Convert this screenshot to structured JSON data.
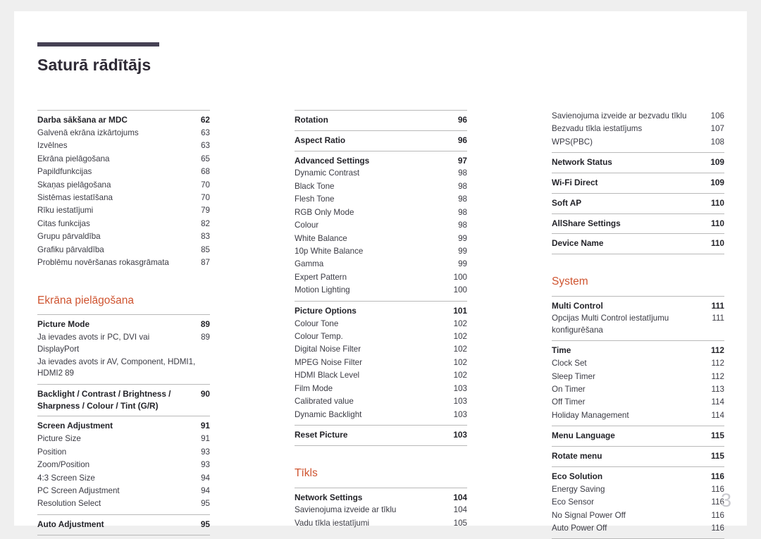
{
  "header": {
    "title": "Saturā rādītājs",
    "rule_color": "#454154",
    "accent_color": "#cf5430"
  },
  "folio": "3",
  "columns": [
    {
      "blocks": [
        {
          "type": "group",
          "entries": [
            {
              "label": "Darba sākšana ar MDC",
              "page": "62",
              "bold": true
            },
            {
              "label": "Galvenā ekrāna izkārtojums",
              "page": "63",
              "bold": false
            },
            {
              "label": "Izvēlnes",
              "page": "63",
              "bold": false
            },
            {
              "label": "Ekrāna pielāgošana",
              "page": "65",
              "bold": false
            },
            {
              "label": "Papildfunkcijas",
              "page": "68",
              "bold": false
            },
            {
              "label": "Skaņas pielāgošana",
              "page": "70",
              "bold": false
            },
            {
              "label": "Sistēmas iestatīšana",
              "page": "70",
              "bold": false
            },
            {
              "label": "Rīku iestatījumi",
              "page": "79",
              "bold": false
            },
            {
              "label": "Citas funkcijas",
              "page": "82",
              "bold": false
            },
            {
              "label": "Grupu pārvaldība",
              "page": "83",
              "bold": false
            },
            {
              "label": "Grafiku pārvaldība",
              "page": "85",
              "bold": false
            },
            {
              "label": "Problēmu novēršanas rokasgrāmata",
              "page": "87",
              "bold": false
            }
          ]
        },
        {
          "type": "heading",
          "label": "Ekrāna pielāgošana"
        },
        {
          "type": "group",
          "entries": [
            {
              "label": "Picture Mode",
              "page": "89",
              "bold": true
            },
            {
              "label": "Ja ievades avots ir PC, DVI vai DisplayPort",
              "page": "89",
              "bold": false,
              "tight": true
            },
            {
              "label": "Ja ievades avots ir AV, Component, HDMI1, HDMI2",
              "page": "89",
              "bold": false,
              "wrap": true
            }
          ]
        },
        {
          "type": "group",
          "entries": [
            {
              "label": "Backlight / Contrast / Brightness / Sharpness / Colour / Tint (G/R)",
              "page": "90",
              "bold": true
            }
          ]
        },
        {
          "type": "group",
          "entries": [
            {
              "label": "Screen Adjustment",
              "page": "91",
              "bold": true
            },
            {
              "label": "Picture Size",
              "page": "91",
              "bold": false
            },
            {
              "label": "Position",
              "page": "93",
              "bold": false
            },
            {
              "label": "Zoom/Position",
              "page": "93",
              "bold": false
            },
            {
              "label": "4:3 Screen Size",
              "page": "94",
              "bold": false
            },
            {
              "label": "PC Screen Adjustment",
              "page": "94",
              "bold": false
            },
            {
              "label": "Resolution Select",
              "page": "95",
              "bold": false
            }
          ]
        },
        {
          "type": "group",
          "last": true,
          "entries": [
            {
              "label": "Auto Adjustment",
              "page": "95",
              "bold": true
            }
          ]
        }
      ]
    },
    {
      "blocks": [
        {
          "type": "group",
          "entries": [
            {
              "label": "Rotation",
              "page": "96",
              "bold": true
            }
          ]
        },
        {
          "type": "group",
          "entries": [
            {
              "label": "Aspect Ratio",
              "page": "96",
              "bold": true
            }
          ]
        },
        {
          "type": "group",
          "entries": [
            {
              "label": "Advanced Settings",
              "page": "97",
              "bold": true
            },
            {
              "label": "Dynamic Contrast",
              "page": "98",
              "bold": false
            },
            {
              "label": "Black Tone",
              "page": "98",
              "bold": false
            },
            {
              "label": "Flesh Tone",
              "page": "98",
              "bold": false
            },
            {
              "label": "RGB Only Mode",
              "page": "98",
              "bold": false
            },
            {
              "label": "Colour",
              "page": "98",
              "bold": false
            },
            {
              "label": "White Balance",
              "page": "99",
              "bold": false
            },
            {
              "label": "10p White Balance",
              "page": "99",
              "bold": false
            },
            {
              "label": "Gamma",
              "page": "99",
              "bold": false
            },
            {
              "label": "Expert Pattern",
              "page": "100",
              "bold": false
            },
            {
              "label": "Motion Lighting",
              "page": "100",
              "bold": false
            }
          ]
        },
        {
          "type": "group",
          "entries": [
            {
              "label": "Picture Options",
              "page": "101",
              "bold": true
            },
            {
              "label": "Colour Tone",
              "page": "102",
              "bold": false
            },
            {
              "label": "Colour Temp.",
              "page": "102",
              "bold": false
            },
            {
              "label": "Digital Noise Filter",
              "page": "102",
              "bold": false
            },
            {
              "label": "MPEG Noise Filter",
              "page": "102",
              "bold": false
            },
            {
              "label": "HDMI Black Level",
              "page": "102",
              "bold": false
            },
            {
              "label": "Film Mode",
              "page": "103",
              "bold": false
            },
            {
              "label": "Calibrated value",
              "page": "103",
              "bold": false
            },
            {
              "label": "Dynamic Backlight",
              "page": "103",
              "bold": false
            }
          ]
        },
        {
          "type": "group",
          "last": true,
          "entries": [
            {
              "label": "Reset Picture",
              "page": "103",
              "bold": true
            }
          ]
        },
        {
          "type": "heading",
          "label": "Tīkls"
        },
        {
          "type": "group",
          "entries": [
            {
              "label": "Network Settings",
              "page": "104",
              "bold": true
            },
            {
              "label": "Savienojuma izveide ar tīklu",
              "page": "104",
              "bold": false
            },
            {
              "label": "Vadu tīkla iestatījumi",
              "page": "105",
              "bold": false
            }
          ]
        }
      ]
    },
    {
      "blocks": [
        {
          "type": "group",
          "plain": true,
          "entries": [
            {
              "label": "Savienojuma izveide ar bezvadu tīklu",
              "page": "106",
              "bold": false
            },
            {
              "label": "Bezvadu tīkla iestatījums",
              "page": "107",
              "bold": false
            },
            {
              "label": "WPS(PBC)",
              "page": "108",
              "bold": false
            }
          ]
        },
        {
          "type": "group",
          "entries": [
            {
              "label": "Network Status",
              "page": "109",
              "bold": true
            }
          ]
        },
        {
          "type": "group",
          "entries": [
            {
              "label": "Wi-Fi Direct",
              "page": "109",
              "bold": true
            }
          ]
        },
        {
          "type": "group",
          "entries": [
            {
              "label": "Soft AP",
              "page": "110",
              "bold": true
            }
          ]
        },
        {
          "type": "group",
          "entries": [
            {
              "label": "AllShare Settings",
              "page": "110",
              "bold": true
            }
          ]
        },
        {
          "type": "group",
          "last": true,
          "entries": [
            {
              "label": "Device Name",
              "page": "110",
              "bold": true
            }
          ]
        },
        {
          "type": "heading",
          "label": "System"
        },
        {
          "type": "group",
          "entries": [
            {
              "label": "Multi Control",
              "page": "111",
              "bold": true
            },
            {
              "label": "Opcijas Multi Control iestatījumu konfigurēšana",
              "page": "111",
              "bold": false,
              "tight": true
            }
          ]
        },
        {
          "type": "group",
          "entries": [
            {
              "label": "Time",
              "page": "112",
              "bold": true
            },
            {
              "label": "Clock Set",
              "page": "112",
              "bold": false
            },
            {
              "label": "Sleep Timer",
              "page": "112",
              "bold": false
            },
            {
              "label": "On Timer",
              "page": "113",
              "bold": false
            },
            {
              "label": "Off Timer",
              "page": "114",
              "bold": false
            },
            {
              "label": "Holiday Management",
              "page": "114",
              "bold": false
            }
          ]
        },
        {
          "type": "group",
          "entries": [
            {
              "label": "Menu Language",
              "page": "115",
              "bold": true
            }
          ]
        },
        {
          "type": "group",
          "entries": [
            {
              "label": "Rotate menu",
              "page": "115",
              "bold": true
            }
          ]
        },
        {
          "type": "group",
          "last": true,
          "entries": [
            {
              "label": "Eco Solution",
              "page": "116",
              "bold": true
            },
            {
              "label": "Energy Saving",
              "page": "116",
              "bold": false
            },
            {
              "label": "Eco Sensor",
              "page": "116",
              "bold": false
            },
            {
              "label": "No Signal Power Off",
              "page": "116",
              "bold": false
            },
            {
              "label": "Auto Power Off",
              "page": "116",
              "bold": false
            }
          ]
        }
      ]
    }
  ]
}
